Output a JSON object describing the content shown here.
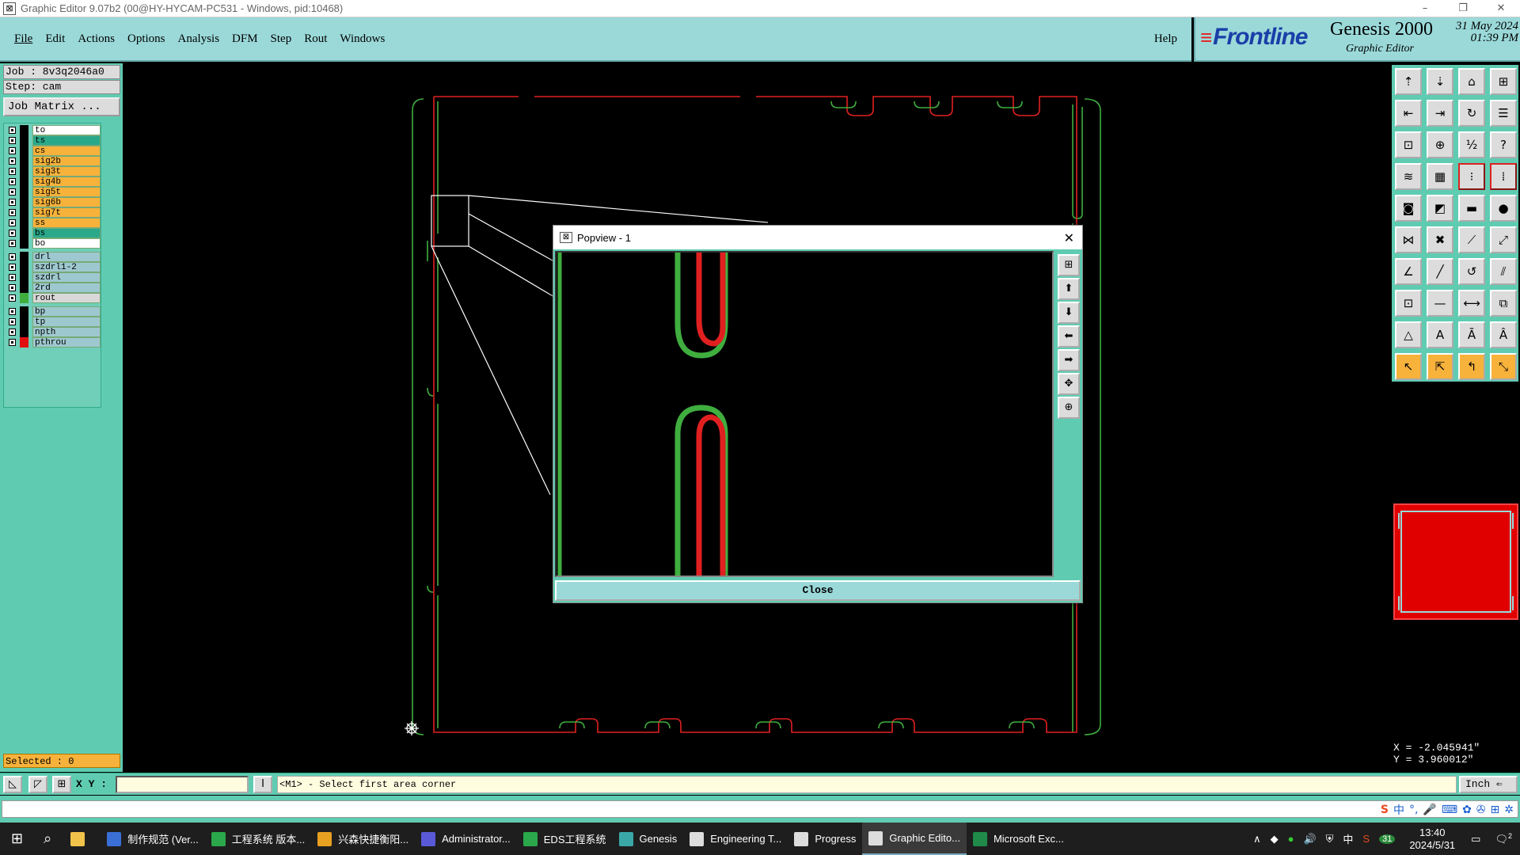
{
  "window": {
    "title": "Graphic Editor 9.07b2 (00@HY-HYCAM-PC531 - Windows, pid:10468)",
    "controls": [
      "–",
      "❐",
      "✕"
    ]
  },
  "menu": {
    "items": [
      "File",
      "Edit",
      "Actions",
      "Options",
      "Analysis",
      "DFM",
      "Step",
      "Rout",
      "Windows"
    ],
    "help": "Help"
  },
  "brand": {
    "logo": "Frontline",
    "product": "Genesis 2000",
    "subtitle": "Graphic Editor",
    "date": "31 May 2024",
    "time": "01:39 PM"
  },
  "job": {
    "job_line": "Job : 8v3q2046a0",
    "step_line": "Step: cam",
    "matrix_button": "Job Matrix ..."
  },
  "layers": [
    {
      "name": "to",
      "color": "#ffffff",
      "swatch": "#000000"
    },
    {
      "name": "ts",
      "color": "#2aa88a",
      "swatch": "#000000"
    },
    {
      "name": "cs",
      "color": "#f7b23b",
      "swatch": "#000000"
    },
    {
      "name": "sig2b",
      "color": "#f7b23b",
      "swatch": "#000000"
    },
    {
      "name": "sig3t",
      "color": "#f7b23b",
      "swatch": "#000000"
    },
    {
      "name": "sig4b",
      "color": "#f7b23b",
      "swatch": "#000000"
    },
    {
      "name": "sig5t",
      "color": "#f7b23b",
      "swatch": "#000000"
    },
    {
      "name": "sig6b",
      "color": "#f7b23b",
      "swatch": "#000000"
    },
    {
      "name": "sig7t",
      "color": "#f7b23b",
      "swatch": "#000000"
    },
    {
      "name": "ss",
      "color": "#f7b23b",
      "swatch": "#000000"
    },
    {
      "name": "bs",
      "color": "#2aa88a",
      "swatch": "#000000"
    },
    {
      "name": "bo",
      "color": "#ffffff",
      "swatch": "#000000"
    },
    {
      "name": "drl",
      "color": "#9ec8cf",
      "swatch": "#000000"
    },
    {
      "name": "szdrl1-2",
      "color": "#9ec8cf",
      "swatch": "#000000"
    },
    {
      "name": "szdrl",
      "color": "#9ec8cf",
      "swatch": "#000000"
    },
    {
      "name": "2rd",
      "color": "#9ec8cf",
      "swatch": "#000000"
    },
    {
      "name": "rout",
      "color": "#d8d8d8",
      "swatch": "#3fae3f"
    },
    {
      "name": "bp",
      "color": "#9ec8cf",
      "swatch": "#000000"
    },
    {
      "name": "tp",
      "color": "#9ec8cf",
      "swatch": "#000000"
    },
    {
      "name": "npth",
      "color": "#9ec8cf",
      "swatch": "#000000"
    },
    {
      "name": "pthrou",
      "color": "#9ec8cf",
      "swatch": "#e01010"
    }
  ],
  "selected_text": "Selected : 0",
  "coords": {
    "x": "X = -2.045941\"",
    "y": "Y = 3.960012\""
  },
  "status": {
    "xy_label": "X Y :",
    "xy_value": "",
    "prompt": "<M1> - Select first area corner",
    "unit": "Inch ⇐"
  },
  "popview": {
    "title": "Popview - 1",
    "close_label": "Close"
  },
  "taskbar": {
    "items": [
      {
        "label": "制作规范 (Ver...",
        "color": "#3b6fd8"
      },
      {
        "label": "工程系统  版本...",
        "color": "#2aa84a"
      },
      {
        "label": "兴森快捷衡阳...",
        "color": "#e8a020"
      },
      {
        "label": "Administrator...",
        "color": "#5a5ad8"
      },
      {
        "label": "EDS工程系统",
        "color": "#2aa84a"
      },
      {
        "label": "Genesis",
        "color": "#3aa8a8"
      },
      {
        "label": "Engineering T...",
        "color": "#dddddd"
      },
      {
        "label": "Progress",
        "color": "#dddddd"
      },
      {
        "label": "Graphic Edito...",
        "color": "#dddddd"
      },
      {
        "label": "Microsoft Exc...",
        "color": "#1f8a4a"
      }
    ],
    "tray_time": "13:40",
    "tray_date": "2024/5/31",
    "lang": "中",
    "badge": "31",
    "notif": "2"
  },
  "ime": {
    "mode": "中"
  }
}
